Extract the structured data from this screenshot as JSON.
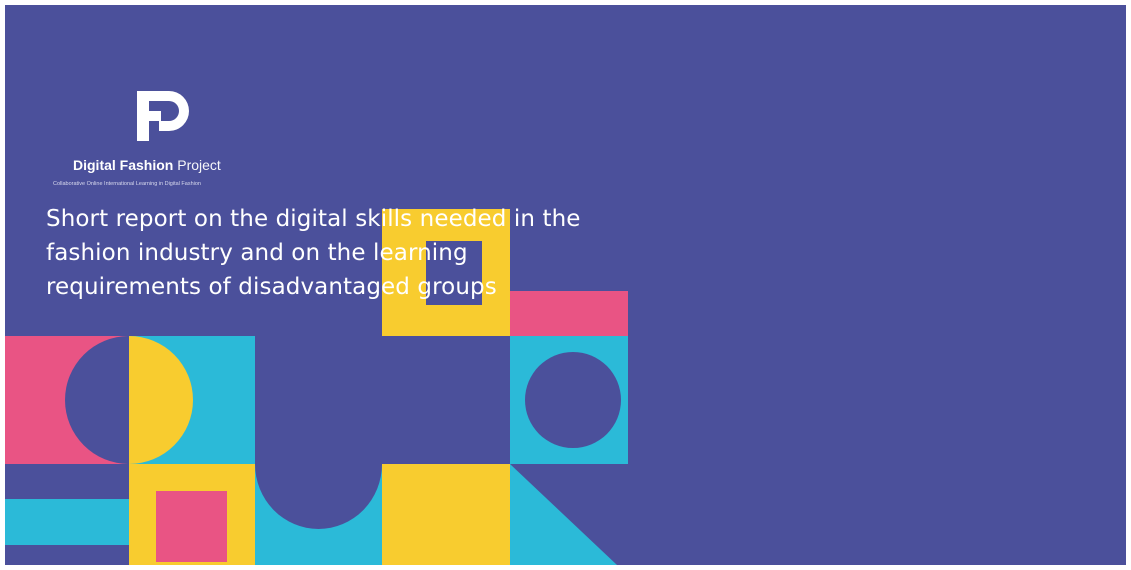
{
  "colors": {
    "background": "#4b509b",
    "pink": "#e95484",
    "cyan": "#2bbad8",
    "yellow": "#f8cc2f",
    "text": "#ffffff"
  },
  "logo": {
    "icon": "digital-fashion-project-monogram",
    "name_bold": "Digital Fashion",
    "name_light": "Project",
    "tagline": "Collaborative Online International Learning in Digital Fashion"
  },
  "title": {
    "lines": [
      "Short report on the digital skills needed in the",
      "fashion industry and on the learning",
      "requirements of disadvantaged groups"
    ]
  }
}
